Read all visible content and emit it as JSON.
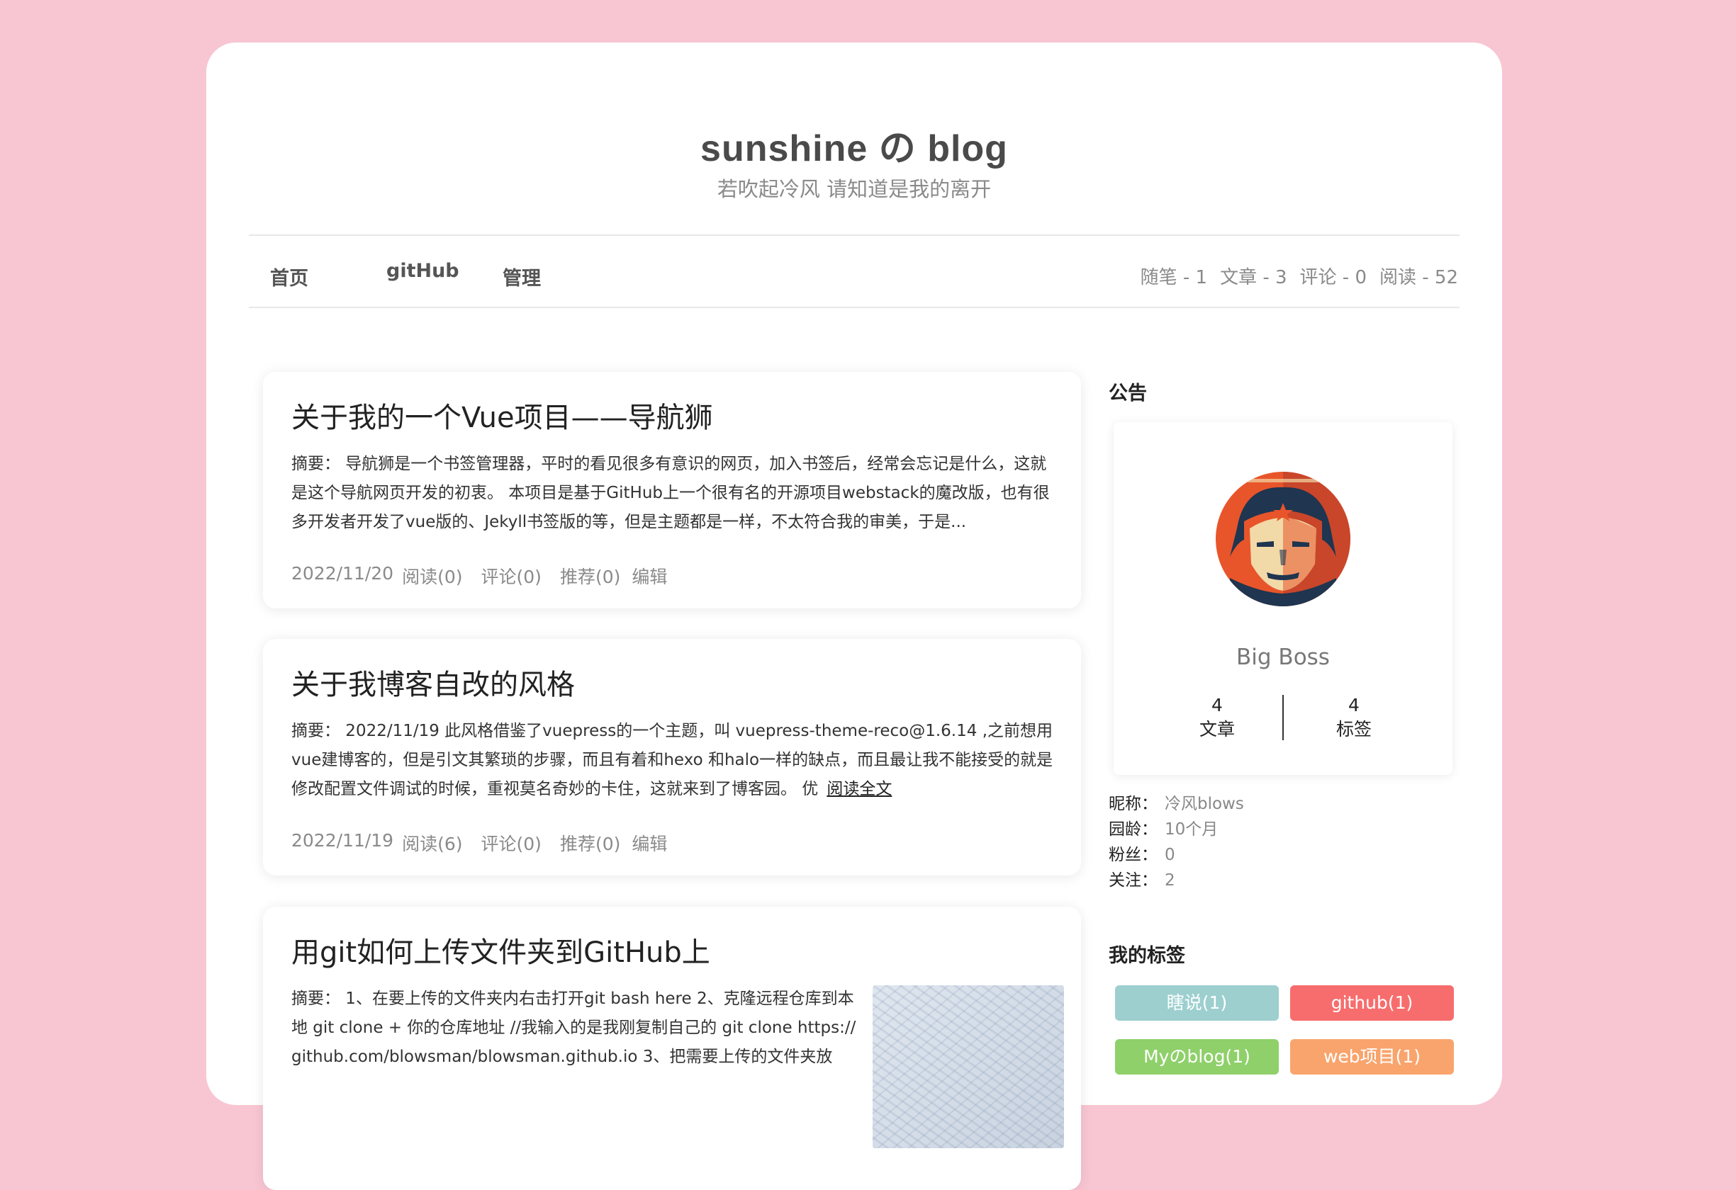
{
  "header": {
    "title": "sunshine の blog",
    "subtitle": "若吹起冷风 请知道是我的离开"
  },
  "nav": {
    "items": [
      "首页",
      "gitHub",
      "管理"
    ],
    "stats": [
      "随笔 - 1",
      "文章 - 3",
      "评论 - 0",
      "阅读 - 52"
    ]
  },
  "posts": [
    {
      "title": "关于我的一个Vue项目——导航狮",
      "summary": "摘要： 导航狮是一个书签管理器，平时的看见很多有意识的网页，加入书签后，经常会忘记是什么，这就是这个导航网页开发的初衷。 本项目是基于GitHub上一个很有名的开源项目webstack的魔改版，也有很多开发者开发了vue版的、Jekyll书签版的等，但是主题都是一样，不太符合我的审美，于是...",
      "read_more": "",
      "date": "2022/11/20",
      "reads": "阅读(0)",
      "comments": "评论(0)",
      "recommends": "推荐(0)",
      "edit": "编辑"
    },
    {
      "title": "关于我博客自改的风格",
      "summary": "摘要： 2022/11/19 此风格借鉴了vuepress的一个主题，叫 vuepress-theme-reco@1.6.14 ,之前想用vue建博客的，但是引文其繁琐的步骤，而且有着和hexo 和halo一样的缺点，而且最让我不能接受的就是修改配置文件调试的时候，重视莫名奇妙的卡住，这就来到了博客园。 优",
      "read_more": "阅读全文",
      "date": "2022/11/19",
      "reads": "阅读(6)",
      "comments": "评论(0)",
      "recommends": "推荐(0)",
      "edit": "编辑"
    },
    {
      "title": "用git如何上传文件夹到GitHub上",
      "summary": "摘要： 1、在要上传的文件夹内右击打开git bash here 2、克隆远程仓库到本地 git clone + 你的仓库地址 //我输入的是我刚复制自己的 git clone https://github.com/blowsman/blowsman.github.io 3、把需要上传的文件夹放"
    }
  ],
  "sidebar": {
    "notice_heading": "公告",
    "profile": {
      "name": "Big Boss",
      "articles_count": "4",
      "articles_label": "文章",
      "tags_count": "4",
      "tags_label": "标签"
    },
    "info": [
      {
        "key": "昵称：",
        "value": "冷风blows"
      },
      {
        "key": "园龄：",
        "value": "10个月"
      },
      {
        "key": "粉丝：",
        "value": "0"
      },
      {
        "key": "关注：",
        "value": "2"
      }
    ],
    "tags_heading": "我的标签",
    "tags": [
      {
        "label": "瞎说(1)",
        "color": "#9dcfcf"
      },
      {
        "label": "github(1)",
        "color": "#f76d6d"
      },
      {
        "label": "Myのblog(1)",
        "color": "#8fd06a"
      },
      {
        "label": "web项目(1)",
        "color": "#f9a46c"
      }
    ]
  },
  "colors": {
    "background": "#f8c6d3",
    "card": "#ffffff"
  }
}
